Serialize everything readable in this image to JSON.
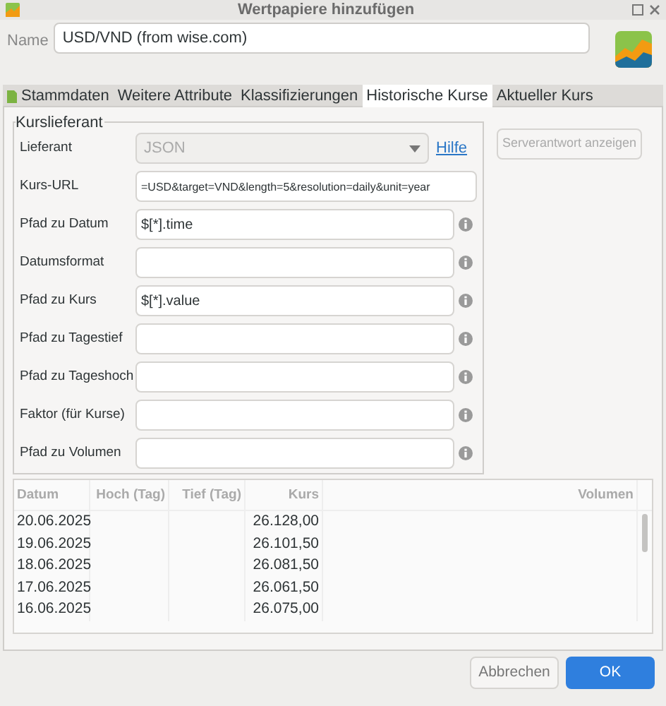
{
  "window": {
    "title": "Wertpapiere hinzufügen"
  },
  "name_field": {
    "label": "Name",
    "value": "USD/VND (from wise.com)"
  },
  "tabs": [
    {
      "label": "Stammdaten",
      "selected": false,
      "kind": "icon"
    },
    {
      "label": "Weitere Attribute",
      "selected": false,
      "kind": "plain"
    },
    {
      "label": "Klassifizierungen",
      "selected": false,
      "kind": "plain"
    },
    {
      "label": "Historische Kurse",
      "selected": true,
      "kind": "plain"
    },
    {
      "label": "Aktueller Kurs",
      "selected": false,
      "kind": "plain"
    }
  ],
  "provider_group": {
    "title": "Kurslieferant",
    "provider": {
      "label": "Lieferant",
      "value": "JSON",
      "disabled": true,
      "help_link": "Hilfe"
    },
    "fields": [
      {
        "label": "Kurs-URL",
        "value": "=USD&target=VND&length=5&resolution=daily&unit=year",
        "info": false
      },
      {
        "label": "Pfad zu Datum",
        "value": "$[*].time",
        "info": true
      },
      {
        "label": "Datumsformat",
        "info": true
      },
      {
        "label": "Pfad zu Kurs",
        "value": "$[*].value",
        "info": true
      },
      {
        "label": "Pfad zu Tagestief",
        "info": true
      },
      {
        "label": "Pfad zu Tageshoch",
        "info": true
      },
      {
        "label": "Faktor (für Kurse)",
        "info": true
      },
      {
        "label": "Pfad zu Volumen",
        "info": true
      }
    ]
  },
  "server_button": {
    "label": "Serverantwort anzeigen",
    "disabled": true
  },
  "table": {
    "columns": [
      "Datum",
      "Hoch (Tag)",
      "Tief (Tag)",
      "Kurs",
      "Volumen"
    ],
    "rows": [
      [
        "20.06.2025",
        "",
        "",
        "26.128,00",
        ""
      ],
      [
        "19.06.2025",
        "",
        "",
        "26.101,50",
        ""
      ],
      [
        "18.06.2025",
        "",
        "",
        "26.081,50",
        ""
      ],
      [
        "17.06.2025",
        "",
        "",
        "26.061,50",
        ""
      ],
      [
        "16.06.2025",
        "",
        "",
        "26.075,00",
        ""
      ]
    ]
  },
  "buttons": [
    {
      "label": "Abbrechen",
      "primary": false
    },
    {
      "label": "OK",
      "primary": true
    }
  ]
}
